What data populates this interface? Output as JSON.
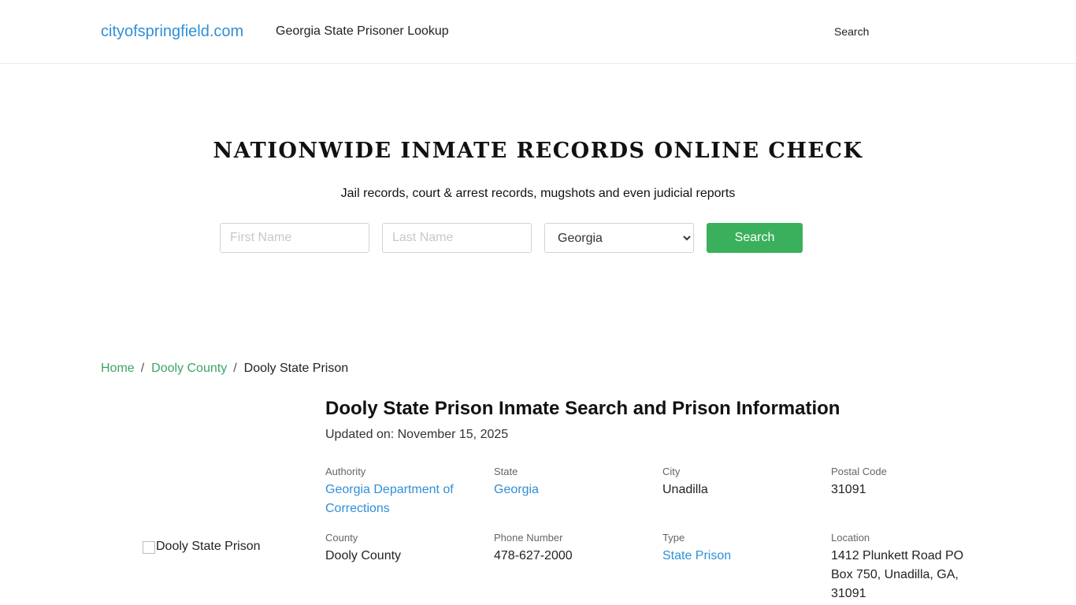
{
  "header": {
    "brand": "cityofspringfield.com",
    "nav_title": "Georgia State Prisoner Lookup",
    "nav_search": "Search"
  },
  "hero": {
    "title": "NATIONWIDE INMATE RECORDS ONLINE CHECK",
    "subtitle": "Jail records, court & arrest records, mugshots and even judicial reports"
  },
  "search_form": {
    "first_name_placeholder": "First Name",
    "last_name_placeholder": "Last Name",
    "state_selected": "Georgia",
    "button_label": "Search"
  },
  "breadcrumb": {
    "home": "Home",
    "county": "Dooly County",
    "current": "Dooly State Prison",
    "separator": "/"
  },
  "facility": {
    "image_alt": "Dooly State Prison",
    "title": "Dooly State Prison Inmate Search and Prison Information",
    "updated": "Updated on: November 15, 2025",
    "authority": {
      "label": "Authority",
      "value": "Georgia Department of Corrections"
    },
    "state": {
      "label": "State",
      "value": "Georgia"
    },
    "city": {
      "label": "City",
      "value": "Unadilla"
    },
    "postal_code": {
      "label": "Postal Code",
      "value": "31091"
    },
    "county": {
      "label": "County",
      "value": "Dooly County"
    },
    "phone": {
      "label": "Phone Number",
      "value": "478-627-2000"
    },
    "type": {
      "label": "Type",
      "value": "State Prison"
    },
    "location": {
      "label": "Location",
      "value": "1412 Plunkett Road PO Box 750, Unadilla, GA, 31091"
    }
  },
  "colors": {
    "link_blue": "#2f8fd8",
    "link_green": "#3aa565",
    "button_green": "#3bb05c"
  }
}
